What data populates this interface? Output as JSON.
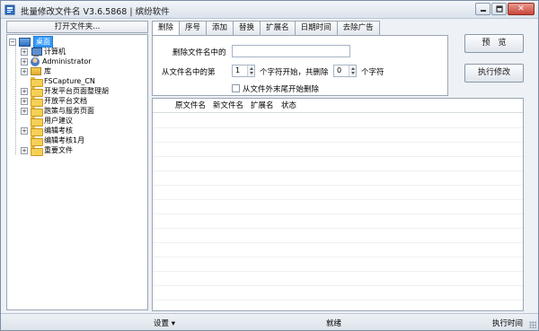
{
  "window": {
    "title": "批量修改文件名 V3.6.5868 | 缤纷软件"
  },
  "left_panel": {
    "open_folder_button": "打开文件夹...",
    "tree": [
      {
        "label": "桌面",
        "level": 0,
        "expand": "-",
        "icon": "desktop-icon",
        "selected": true
      },
      {
        "label": "计算机",
        "level": 1,
        "expand": "+",
        "icon": "computer-icon"
      },
      {
        "label": "Administrator",
        "level": 1,
        "expand": "+",
        "icon": "user-icon"
      },
      {
        "label": "库",
        "level": 1,
        "expand": "+",
        "icon": "library-icon"
      },
      {
        "label": "FSCapture_CN",
        "level": 1,
        "expand": "",
        "icon": "folder-icon"
      },
      {
        "label": "开发平台页面整理胡",
        "level": 1,
        "expand": "+",
        "icon": "folder-icon"
      },
      {
        "label": "开放平台文档",
        "level": 1,
        "expand": "+",
        "icon": "folder-icon"
      },
      {
        "label": "跑策与服务页面",
        "level": 1,
        "expand": "+",
        "icon": "folder-icon"
      },
      {
        "label": "用户建议",
        "level": 1,
        "expand": "",
        "icon": "folder-icon"
      },
      {
        "label": "编辑考核",
        "level": 1,
        "expand": "+",
        "icon": "folder-icon"
      },
      {
        "label": "编辑考核1月",
        "level": 1,
        "expand": "",
        "icon": "folder-icon"
      },
      {
        "label": "重要文件",
        "level": 1,
        "expand": "+",
        "icon": "folder-icon"
      }
    ]
  },
  "tabs": [
    {
      "label": "删除",
      "active": true
    },
    {
      "label": "序号"
    },
    {
      "label": "添加"
    },
    {
      "label": "替换"
    },
    {
      "label": "扩展名"
    },
    {
      "label": "日期时间"
    },
    {
      "label": "去除广告"
    }
  ],
  "delete_panel": {
    "delete_in_name_label": "删除文件名中的",
    "delete_in_name_value": "",
    "from_position_label": "从文件名中的第",
    "start_value": "1",
    "start_suffix": "个字符开始，共删除",
    "count_value": "0",
    "count_suffix": "个字符",
    "from_end_checkbox_label": "从文件外末尾开始删除",
    "from_end_checked": false
  },
  "buttons": {
    "preview": "预　览",
    "execute": "执行修改"
  },
  "table": {
    "columns": [
      "原文件名",
      "新文件名",
      "扩展名",
      "状态"
    ],
    "rows": []
  },
  "status_bar": {
    "settings": "设置 ▾",
    "status": "就绪",
    "exec_time": "执行时间"
  },
  "colors": {
    "selection": "#3399ff",
    "folder": "#f6cf55",
    "close_button": "#c9453a"
  }
}
